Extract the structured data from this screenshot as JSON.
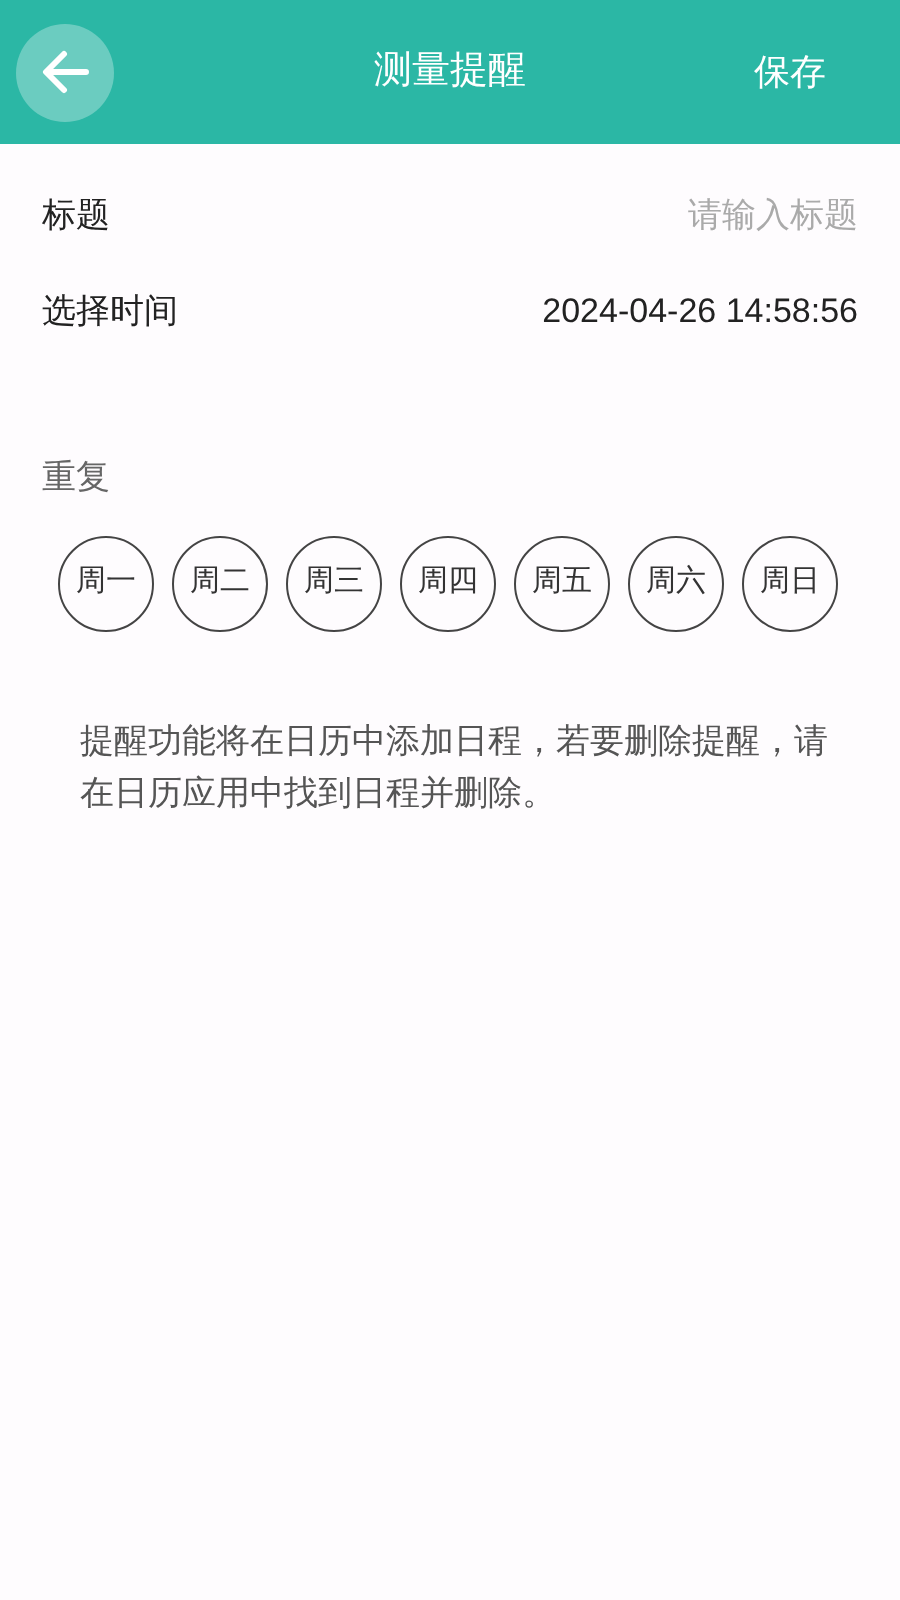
{
  "header": {
    "title": "测量提醒",
    "action": "保存"
  },
  "title_field": {
    "label": "标题",
    "placeholder": "请输入标题"
  },
  "time_field": {
    "label": "选择时间",
    "value": "2024-04-26 14:58:56"
  },
  "repeat": {
    "label": "重复",
    "days": [
      {
        "label": "周一",
        "selected": false
      },
      {
        "label": "周二",
        "selected": false
      },
      {
        "label": "周三",
        "selected": false
      },
      {
        "label": "周四",
        "selected": false
      },
      {
        "label": "周五",
        "selected": false
      },
      {
        "label": "周六",
        "selected": false
      },
      {
        "label": "周日",
        "selected": false
      }
    ]
  },
  "note": "提醒功能将在日历中添加日程，若要删除提醒，请在日历应用中找到日程并删除。"
}
